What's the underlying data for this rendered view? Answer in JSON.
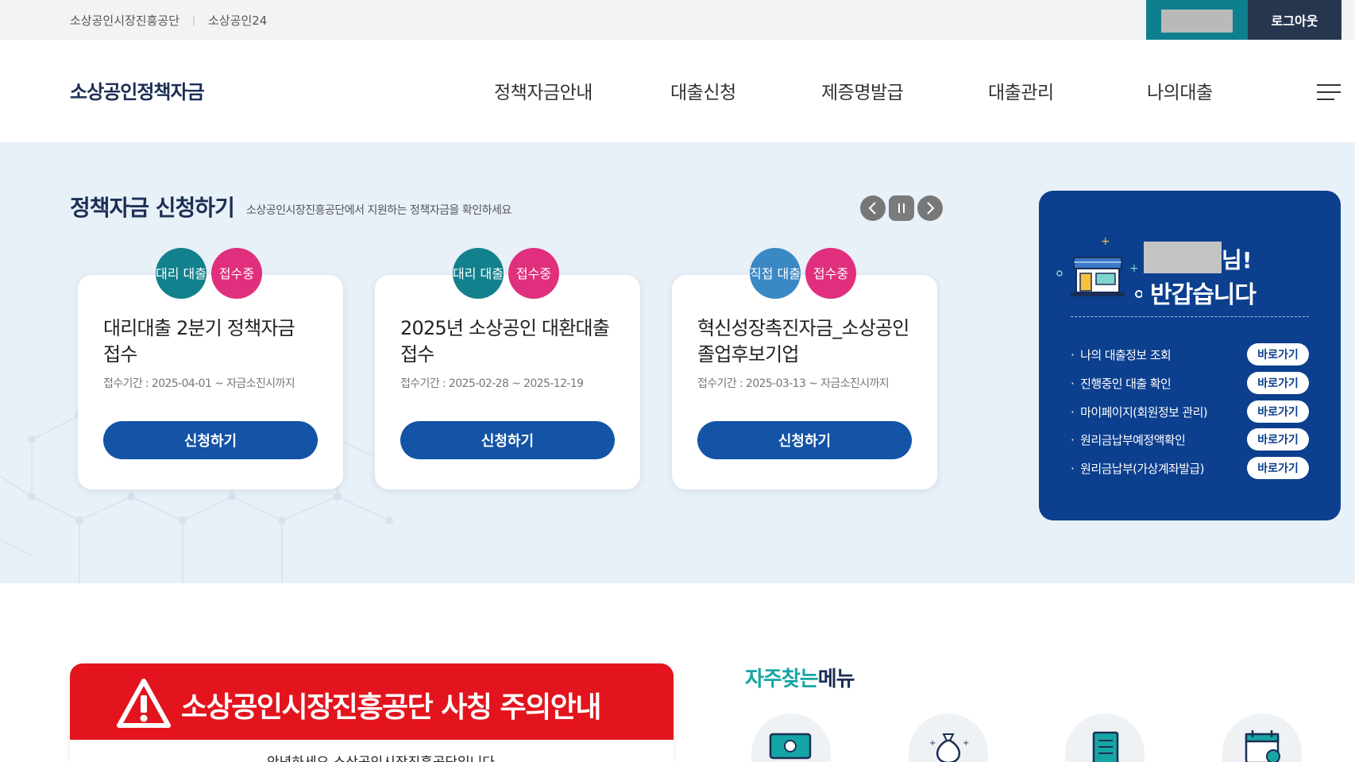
{
  "topbar": {
    "links": [
      "소상공인시장진흥공단",
      "소상공인24"
    ],
    "separator": "|",
    "logout_label": "로그아웃"
  },
  "header": {
    "logo": "소상공인정책자금",
    "nav": [
      "정책자금안내",
      "대출신청",
      "제증명발급",
      "대출관리",
      "나의대출"
    ]
  },
  "hero": {
    "title": "정책자금 신청하기",
    "subtitle": "소상공인시장진흥공단에서 지원하는 정책자금을 확인하세요",
    "cards": [
      {
        "type_badge": "대리 대출",
        "status_badge": "접수중",
        "title": "대리대출 2분기 정책자금 접수",
        "period": "접수기간 : 2025-04-01 ~ 자금소진시까지",
        "button": "신청하기"
      },
      {
        "type_badge": "대리 대출",
        "status_badge": "접수중",
        "title": "2025년 소상공인 대환대출 접수",
        "period": "접수기간 : 2025-02-28 ~ 2025-12-19",
        "button": "신청하기"
      },
      {
        "type_badge": "직접 대출",
        "status_badge": "접수중",
        "title": "혁신성장촉진자금_소상공인 졸업후보기업",
        "period": "접수기간 : 2025-03-13 ~ 자금소진시까지",
        "button": "신청하기"
      }
    ]
  },
  "welcome": {
    "greeting_suffix": "님!",
    "greeting": "반갑습니다",
    "quick_links": [
      {
        "label": "나의 대출정보 조회",
        "button": "바로가기"
      },
      {
        "label": "진행중인 대출 확인",
        "button": "바로가기"
      },
      {
        "label": "마이페이지(회원정보 관리)",
        "button": "바로가기"
      },
      {
        "label": "원리금납부예정액확인",
        "button": "바로가기"
      },
      {
        "label": "원리금납부(가상계좌발급)",
        "button": "바로가기"
      }
    ]
  },
  "notice": {
    "title": "소상공인시장진흥공단 사칭 주의안내",
    "text": "안녕하세요 소상공인시장진흥공단입니다"
  },
  "faq": {
    "title_accent": "자주찾는",
    "title_rest": "메뉴"
  },
  "colors": {
    "navy": "#1b2e55",
    "primary_blue": "#1453a6",
    "panel_blue": "#0c3f8e",
    "teal": "#13808d",
    "pink": "#e02f7d",
    "alert_red": "#e3141d",
    "hero_bg": "#e8f0f8"
  }
}
